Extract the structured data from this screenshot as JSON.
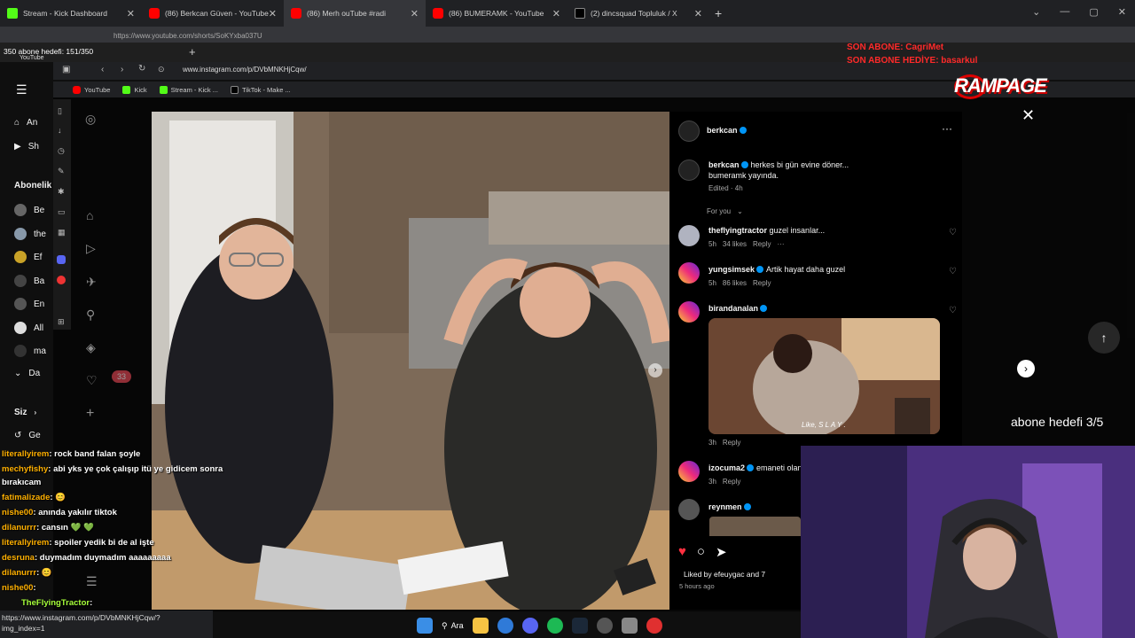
{
  "outer_tabs": [
    {
      "label": "Stream - Kick Dashboard",
      "favicon": "kick"
    },
    {
      "label": "(86) Berkcan Güven - YouTube",
      "favicon": "yt"
    },
    {
      "label": "(86) Merh ouTube #radi",
      "favicon": "yt"
    },
    {
      "label": "(86) BUMERAMK - YouTube",
      "favicon": "yt"
    },
    {
      "label": "(2) dincsquad Topluluk / X",
      "favicon": "x"
    }
  ],
  "outer_url": "https://www.youtube.com/shorts/SoKYxba037U",
  "inner": {
    "subs_counter": "350 abone hedefi: 151/350",
    "yt_mini": "YouTube",
    "url": "www.instagram.com/p/DVbMNKHjCqw/",
    "bookmarks": [
      {
        "label": "YouTube",
        "favicon": "yt"
      },
      {
        "label": "Kick",
        "favicon": "kick"
      },
      {
        "label": "Stream - Kick ...",
        "favicon": "kick"
      },
      {
        "label": "TikTok - Make ...",
        "favicon": "x"
      }
    ]
  },
  "yt_sidebar": {
    "home": "An",
    "shorts": "Sh",
    "subs_header": "Abonelik",
    "channels": [
      "Be",
      "the",
      "Ef",
      "Ba",
      "En",
      "All",
      "ma"
    ],
    "more": "Da",
    "you_header": "Siz",
    "history": "Ge"
  },
  "overlay_badges": {
    "son_abone": "SON ABONE: CagriMet",
    "son_hediye": "SON ABONE HEDİYE: basarkul",
    "brand": "RAMPAGE",
    "goal": "abone hedefi 3/5",
    "notif_count": "33"
  },
  "post": {
    "author": "berkcan",
    "caption_line1": "herkes bi gün evine döner...",
    "caption_line2": "bumeramk yayında.",
    "edited": "Edited · 4h",
    "sort": "For you",
    "comments": [
      {
        "user": "theflyingtractor",
        "text": "guzel insanlar...",
        "time": "5h",
        "likes": "34 likes",
        "reply": "Reply",
        "verified": false
      },
      {
        "user": "yungsimsek",
        "text": "Artik hayat daha guzel",
        "time": "5h",
        "likes": "86 likes",
        "reply": "Reply",
        "verified": true
      },
      {
        "user": "birandanalan",
        "text": "",
        "time": "3h",
        "likes": "",
        "reply": "Reply",
        "verified": true,
        "gif_caption": "Like, S L A Y ."
      },
      {
        "user": "izocuma2",
        "text": "emaneti olan",
        "time": "3h",
        "likes": "",
        "reply": "Reply",
        "verified": true
      },
      {
        "user": "reynmen",
        "text": "",
        "time": "",
        "likes": "",
        "reply": "",
        "verified": true
      }
    ],
    "liked_by": "Liked by efeuygac and 7",
    "hours_ago": "5 hours ago"
  },
  "chat": [
    {
      "user": "literallyirem",
      "msg": ": rock band falan şoyle"
    },
    {
      "user": "mechyfishy",
      "msg": ": abi yks ye çok çalışıp itü ye gidicem sonra"
    },
    {
      "user": "",
      "msg": "bırakıcam"
    },
    {
      "user": "fatimalizade",
      "msg": ": 😊"
    },
    {
      "user": "nishe00",
      "msg": ": anında yakılır tiktok"
    },
    {
      "user": "dilanurrr",
      "msg": ": cansın 💚 💚"
    },
    {
      "user": "literallyirem",
      "msg": ": spoiler yedik bi de al işte"
    },
    {
      "user": "desruna",
      "msg": ": duymadım duymadım aaaaaaaaa"
    },
    {
      "user": "dilanurrr",
      "msg": ": 😊"
    },
    {
      "user": "nishe00",
      "msg": ":"
    },
    {
      "user": "TheFlyingTractor",
      "msg": ":"
    }
  ],
  "status_url_line1": "https://www.instagram.com/p/DVbMNKHjCqw/?",
  "status_url_line2": "img_index=1",
  "taskbar_search": "Ara"
}
